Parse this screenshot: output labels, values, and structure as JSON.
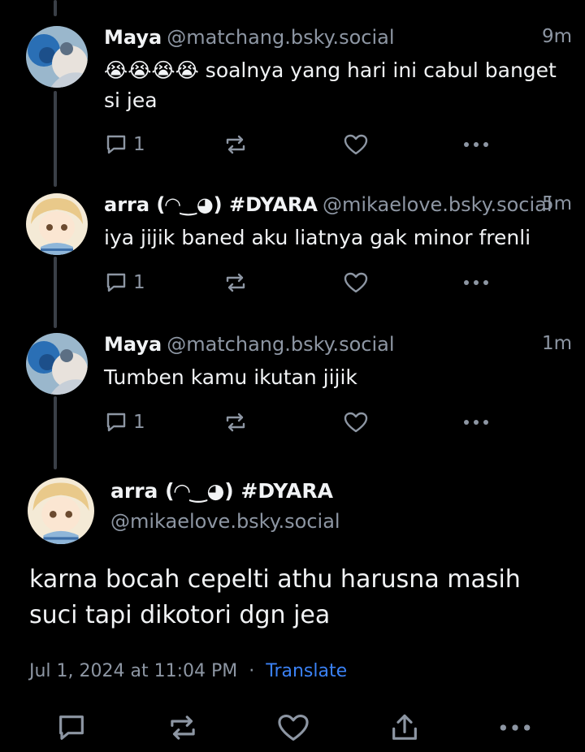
{
  "posts": [
    {
      "name": "Maya",
      "handle": "@matchang.bsky.social",
      "time": "9m",
      "text": "😭😭😭😭 soalnya yang hari ini cabul banget si jea",
      "reply_count": "1"
    },
    {
      "name": "arra (◠‿◕) #DYARA",
      "handle": "@mikaelove.bsky.social",
      "time": "5m",
      "text": "iya jijik baned aku liatnya gak minor frenli",
      "reply_count": "1"
    },
    {
      "name": "Maya",
      "handle": "@matchang.bsky.social",
      "time": "1m",
      "text": "Tumben kamu ikutan jijik",
      "reply_count": "1"
    }
  ],
  "main": {
    "name": "arra (◠‿◕) #DYARA",
    "handle": "@mikaelove.bsky.social",
    "text": "karna bocah cepelti athu harusna masih suci tapi dikotori dgn jea",
    "date": "Jul 1, 2024 at 11:04 PM",
    "separator": "·",
    "translate": "Translate"
  },
  "icons": {
    "reply": "reply-icon",
    "repost": "repost-icon",
    "like": "heart-icon",
    "more": "more-icon",
    "share": "share-icon"
  },
  "colors": {
    "background": "#000000",
    "text": "#f1f3f5",
    "muted": "#8d96a3",
    "link": "#3b82f6"
  }
}
